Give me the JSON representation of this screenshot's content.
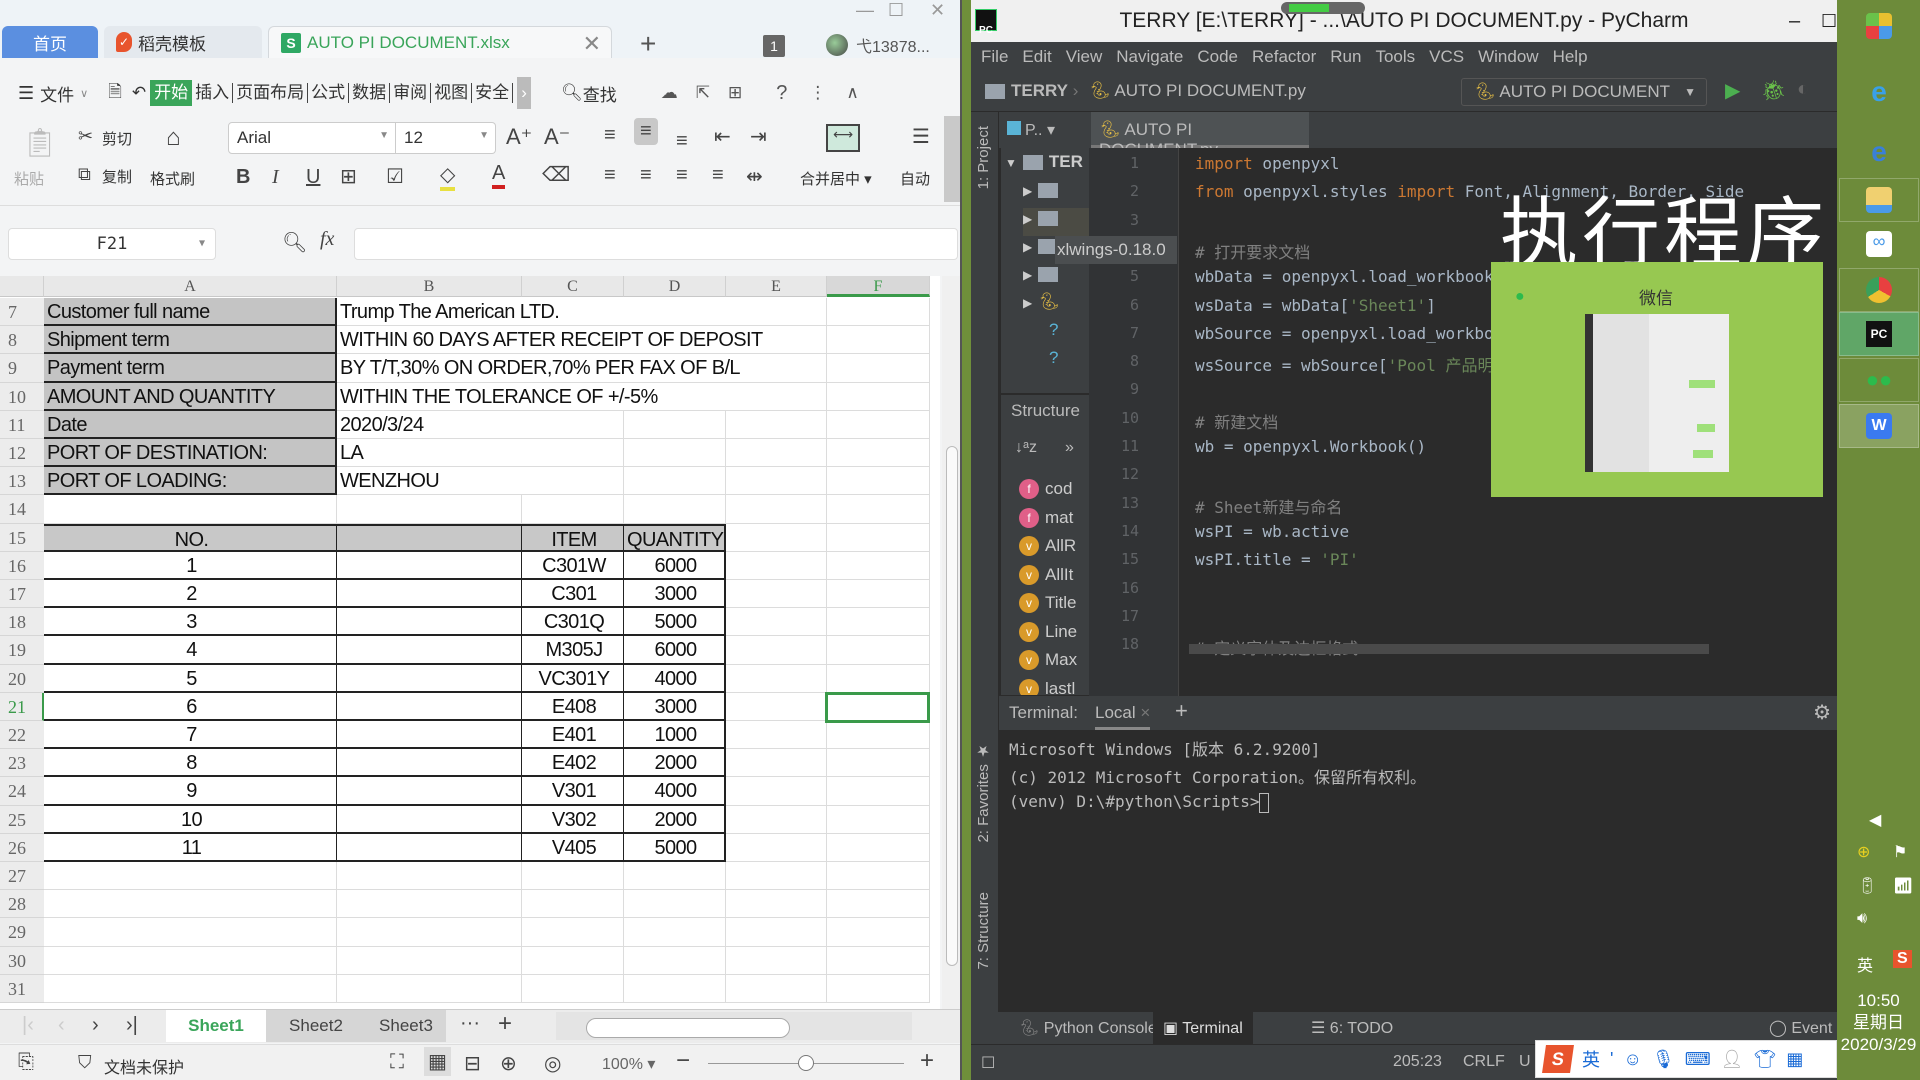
{
  "wps": {
    "tabs": {
      "home": "首页",
      "template": "稻壳模板",
      "document": "AUTO PI DOCUMENT.xlsx"
    },
    "window_count": "1",
    "user": "弋13878...",
    "menu": {
      "file": "文件",
      "items": [
        "开始",
        "插入",
        "页面布局",
        "公式",
        "数据",
        "审阅",
        "视图",
        "安全"
      ],
      "active": "开始",
      "search": "查找"
    },
    "toolbar": {
      "paste": "粘贴",
      "cut": "剪切",
      "copy": "复制",
      "format_painter": "格式刷",
      "font": "Arial",
      "font_size": "12",
      "merge_center": "合并居中",
      "auto_wrap": "自动"
    },
    "name_box": "F21",
    "formula": "",
    "columns": [
      "A",
      "B",
      "C",
      "D",
      "E",
      "F"
    ],
    "selected_cell": "F21",
    "info_rows": [
      {
        "row": "7",
        "label": "Customer full name",
        "value": "Trump The American LTD."
      },
      {
        "row": "8",
        "label": "Shipment term",
        "value": "WITHIN 60 DAYS AFTER RECEIPT OF DEPOSIT"
      },
      {
        "row": "9",
        "label": "Payment term",
        "value": "BY T/T,30% ON ORDER,70% PER FAX OF B/L"
      },
      {
        "row": "10",
        "label": "AMOUNT AND QUANTITY",
        "value": "WITHIN THE TOLERANCE OF +/-5%"
      },
      {
        "row": "11",
        "label": "Date",
        "value": "2020/3/24"
      },
      {
        "row": "12",
        "label": "PORT OF DESTINATION:",
        "value": "LA"
      },
      {
        "row": "13",
        "label": "PORT OF LOADING:",
        "value": "WENZHOU"
      }
    ],
    "table_header": {
      "row": "15",
      "no": "NO.",
      "item": "ITEM",
      "quantity": "QUANTITY"
    },
    "table_rows": [
      {
        "row": "16",
        "no": "1",
        "item": "C301W",
        "quantity": "6000"
      },
      {
        "row": "17",
        "no": "2",
        "item": "C301",
        "quantity": "3000"
      },
      {
        "row": "18",
        "no": "3",
        "item": "C301Q",
        "quantity": "5000"
      },
      {
        "row": "19",
        "no": "4",
        "item": "M305J",
        "quantity": "6000"
      },
      {
        "row": "20",
        "no": "5",
        "item": "VC301Y",
        "quantity": "4000"
      },
      {
        "row": "21",
        "no": "6",
        "item": "E408",
        "quantity": "3000"
      },
      {
        "row": "22",
        "no": "7",
        "item": "E401",
        "quantity": "1000"
      },
      {
        "row": "23",
        "no": "8",
        "item": "E402",
        "quantity": "2000"
      },
      {
        "row": "24",
        "no": "9",
        "item": "V301",
        "quantity": "4000"
      },
      {
        "row": "25",
        "no": "10",
        "item": "V302",
        "quantity": "2000"
      },
      {
        "row": "26",
        "no": "11",
        "item": "V405",
        "quantity": "5000"
      }
    ],
    "empty_rows": [
      "14",
      "27",
      "28",
      "29",
      "30",
      "31"
    ],
    "sheets": [
      "Sheet1",
      "Sheet2",
      "Sheet3"
    ],
    "active_sheet": "Sheet1",
    "status": {
      "protect": "文档未保护",
      "zoom": "100%"
    },
    "zoom_fraction": 0.5
  },
  "pycharm": {
    "title": "TERRY [E:\\TERRY] - ...\\AUTO PI DOCUMENT.py - PyCharm",
    "menu": [
      "File",
      "Edit",
      "View",
      "Navigate",
      "Code",
      "Refactor",
      "Run",
      "Tools",
      "VCS",
      "Window",
      "Help"
    ],
    "breadcrumb": {
      "project": "TERRY",
      "file": "AUTO PI DOCUMENT.py"
    },
    "run_config": "AUTO PI DOCUMENT",
    "editor_tab": "AUTO PI DOCUMENT.py",
    "project_tab": "P..",
    "project_root": "TER",
    "tooltip": "xlwings-0.18.0",
    "left_tools": {
      "project": "1: Project",
      "favorites": "2: Favorites",
      "structure": "7: Structure"
    },
    "structure_title": "Structure",
    "structure_items": [
      {
        "kind": "f",
        "name": "cod"
      },
      {
        "kind": "f",
        "name": "mat"
      },
      {
        "kind": "v",
        "name": "AllR"
      },
      {
        "kind": "v",
        "name": "AllIt"
      },
      {
        "kind": "v",
        "name": "Title"
      },
      {
        "kind": "v",
        "name": "Line"
      },
      {
        "kind": "v",
        "name": "Max"
      },
      {
        "kind": "v",
        "name": "lastl"
      }
    ],
    "code_lines": [
      {
        "n": "1",
        "html": "<span class='kw'>import</span> openpyxl"
      },
      {
        "n": "2",
        "html": "<span class='kw'>from</span> openpyxl.styles <span class='kw'>import</span> Font, Alignment, Border, Side"
      },
      {
        "n": "3",
        "html": ""
      },
      {
        "n": "4",
        "html": "<span class='cm'># 打开要求文档</span>"
      },
      {
        "n": "5",
        "html": "wbData = openpyxl.load_workbook("
      },
      {
        "n": "6",
        "html": "wsData = wbData[<span class='str'>'Sheet1'</span>]"
      },
      {
        "n": "7",
        "html": "wbSource = openpyxl.load_workbook("
      },
      {
        "n": "8",
        "html": "wsSource = wbSource[<span class='str'>'Pool 产品明细'</span>]"
      },
      {
        "n": "9",
        "html": ""
      },
      {
        "n": "10",
        "html": "<span class='cm'># 新建文档</span>"
      },
      {
        "n": "11",
        "html": "wb = openpyxl.Workbook()"
      },
      {
        "n": "12",
        "html": ""
      },
      {
        "n": "13",
        "html": "<span class='cm'># Sheet新建与命名</span>"
      },
      {
        "n": "14",
        "html": "wsPI = wb.active"
      },
      {
        "n": "15",
        "html": "wsPI.title = <span class='str'>'PI'</span>"
      },
      {
        "n": "16",
        "html": ""
      },
      {
        "n": "17",
        "html": ""
      },
      {
        "n": "18",
        "html": "<span class='cm'># 定义字体及边框格式</span>"
      }
    ],
    "terminal": {
      "label": "Terminal:",
      "tab": "Local",
      "lines": [
        "Microsoft Windows [版本 6.2.9200]",
        "(c) 2012 Microsoft Corporation。保留所有权利。",
        "(venv) D:\\#python\\Scripts>"
      ]
    },
    "bottom_tabs": [
      "Python Console",
      "Terminal",
      "6: TODO"
    ],
    "active_bottom_tab": "Terminal",
    "event_log": "Event Log",
    "status": {
      "position": "205:23",
      "line_sep": "CRLF",
      "encoding": "U"
    }
  },
  "overlay": {
    "caption": "执行程序",
    "wechat_preview_title": "微信"
  },
  "ime": {
    "lang": "英",
    "punct": "'"
  },
  "taskbar": {
    "apps": [
      "app-center",
      "ie-blue",
      "ie-classic",
      "file-explorer",
      "baidu-netdisk",
      "chrome",
      "pycharm",
      "wechat",
      "wps"
    ],
    "active_app": "pycharm",
    "tray_lang": "英",
    "time": "10:50",
    "weekday": "星期日",
    "date": "2020/3/29"
  }
}
